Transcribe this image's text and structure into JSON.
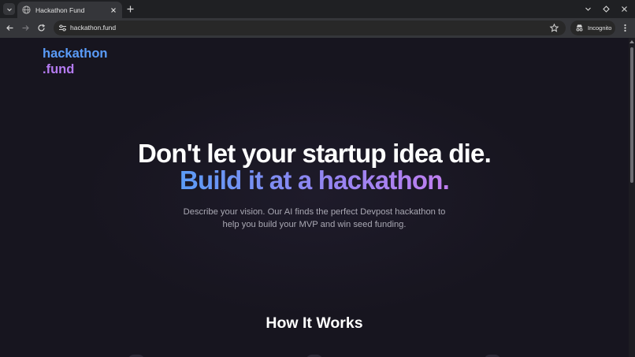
{
  "browser": {
    "tab_title": "Hackathon Fund",
    "url": "hackathon.fund",
    "incognito_label": "Incognito"
  },
  "site": {
    "logo_line1": "hackathon",
    "logo_line2": ".fund",
    "hero_line1": "Don't let your startup idea die.",
    "hero_line2": "Build it at a hackathon.",
    "subtitle_line1": "Describe your vision. Our AI finds the perfect Devpost hackathon to",
    "subtitle_line2": "help you build your MVP and win seed funding.",
    "how_heading": "How It Works"
  },
  "colors": {
    "page_bg": "#17151f",
    "logo_blue": "#5a9cf8",
    "logo_purple": "#b57bf2",
    "gradient_start": "#5b9cf6",
    "gradient_end": "#c07ef0"
  },
  "icons": [
    "tab-search-icon",
    "globe-icon",
    "close-icon",
    "plus-icon",
    "chevron-down-icon",
    "minimize-icon",
    "close-window-icon",
    "back-icon",
    "forward-icon",
    "reload-icon",
    "site-settings-icon",
    "star-icon",
    "incognito-icon",
    "kebab-menu-icon"
  ]
}
